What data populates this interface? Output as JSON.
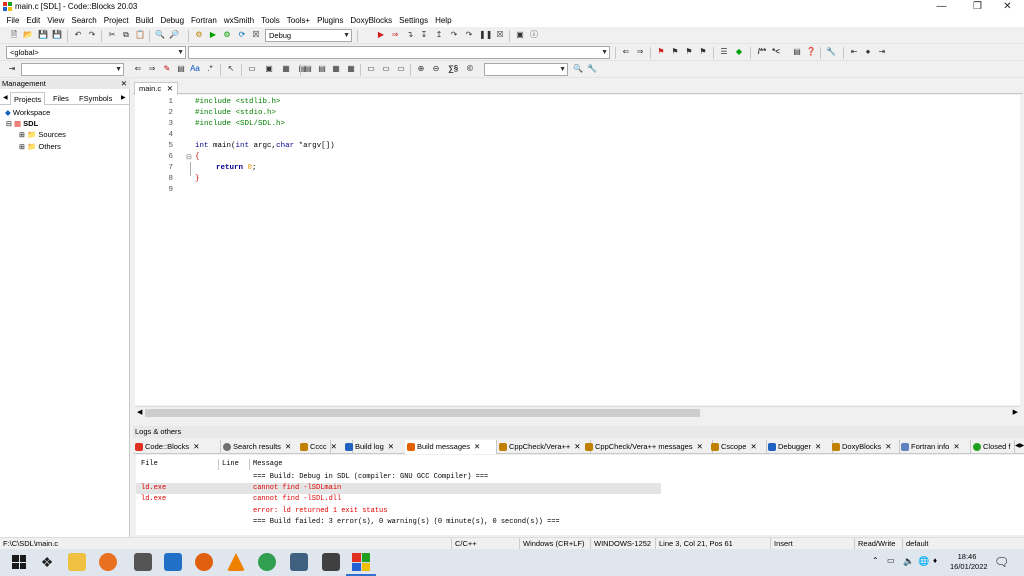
{
  "window": {
    "title": "main.c [SDL] - Code::Blocks 20.03"
  },
  "menu": [
    "File",
    "Edit",
    "View",
    "Search",
    "Project",
    "Build",
    "Debug",
    "Fortran",
    "wxSmith",
    "Tools",
    "Tools+",
    "Plugins",
    "DoxyBlocks",
    "Settings",
    "Help"
  ],
  "toolbar": {
    "build_target": "Debug",
    "scope": "<global>",
    "symbol": "",
    "search_combo": "",
    "comment_labels": [
      "/**",
      "*<"
    ]
  },
  "management": {
    "header": "Management",
    "tabs": [
      "Projects",
      "Files",
      "FSymbols"
    ],
    "tree": {
      "workspace": "Workspace",
      "project": "SDL",
      "folders": [
        "Sources",
        "Others"
      ]
    }
  },
  "editor": {
    "tab": "main.c",
    "line_numbers": [
      "1",
      "2",
      "3",
      "4",
      "5",
      "6",
      "7",
      "8",
      "9"
    ]
  },
  "code": {
    "l1": "#include <stdlib.h>",
    "l2": "#include <stdio.h>",
    "l3": "#include <SDL/SDL.h>",
    "l5_kw": "int",
    "l5_fn": " main(",
    "l5_kw2": "int",
    "l5_a": " argc,",
    "l5_kw3": "char",
    "l5_b": " *argv[])",
    "l6": "{",
    "l7_kw": "return",
    "l7_num": "0",
    "l7_end": ";",
    "l8": "}"
  },
  "logs": {
    "header": "Logs & others",
    "tabs": [
      "Code::Blocks",
      "Search results",
      "Cccc",
      "Build log",
      "Build messages",
      "CppCheck/Vera++",
      "CppCheck/Vera++ messages",
      "Cscope",
      "Debugger",
      "DoxyBlocks",
      "Fortran info",
      "Closed f"
    ],
    "columns": {
      "file": "File",
      "line": "Line",
      "message": "Message"
    },
    "rows": [
      {
        "file": "",
        "line": "",
        "message": "=== Build: Debug in SDL (compiler: GNU GCC Compiler) ===",
        "red": false
      },
      {
        "file": "ld.exe",
        "line": "",
        "message": "cannot find -lSDLmain",
        "red": true
      },
      {
        "file": "ld.exe",
        "line": "",
        "message": "cannot find -lSDL.dll",
        "red": true
      },
      {
        "file": "",
        "line": "",
        "message": "error: ld returned 1 exit status",
        "red": true
      },
      {
        "file": "",
        "line": "",
        "message": "=== Build failed: 3 error(s), 0 warning(s) (0 minute(s), 0 second(s)) ===",
        "red": false
      }
    ]
  },
  "status": {
    "path": "F:\\C\\SDL\\main.c",
    "language": "C/C++",
    "eol": "Windows (CR+LF)",
    "encoding": "WINDOWS-1252",
    "position": "Line 3, Col 21, Pos 61",
    "mode": "Insert",
    "access": "Read/Write",
    "profile": "default"
  },
  "taskbar": {
    "time": "18:46",
    "date": "16/01/2022"
  }
}
